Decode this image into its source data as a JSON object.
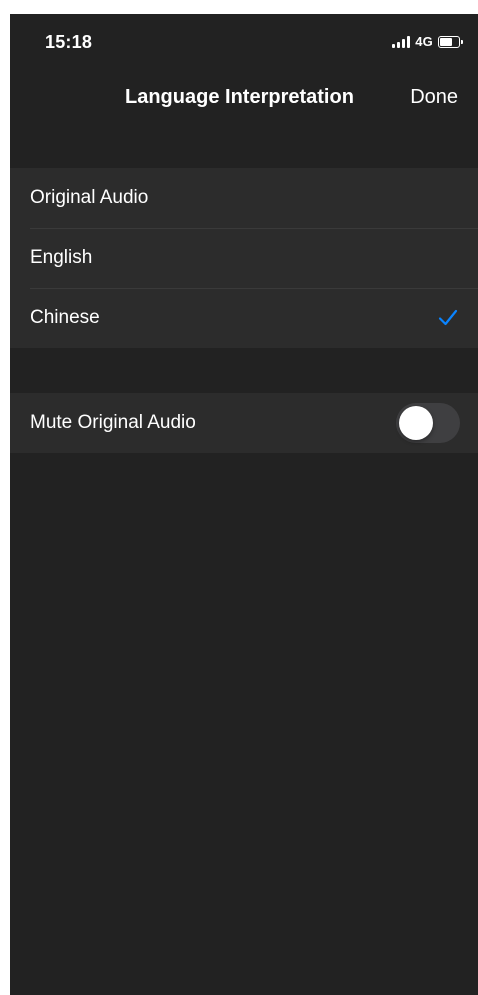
{
  "status_bar": {
    "time": "15:18",
    "network": "4G",
    "battery_level": 0.75
  },
  "nav": {
    "title": "Language Interpretation",
    "done_label": "Done"
  },
  "languages": {
    "items": [
      {
        "label": "Original Audio",
        "selected": false
      },
      {
        "label": "English",
        "selected": false
      },
      {
        "label": "Chinese",
        "selected": true
      }
    ]
  },
  "mute": {
    "label": "Mute Original Audio",
    "enabled": false
  },
  "colors": {
    "accent": "#0a84ff",
    "background": "#222222",
    "cell": "#2c2c2c",
    "toggle_off": "#3f3f41"
  },
  "icons": {
    "check": "checkmark-icon",
    "signal": "signal-icon",
    "battery": "battery-icon"
  }
}
